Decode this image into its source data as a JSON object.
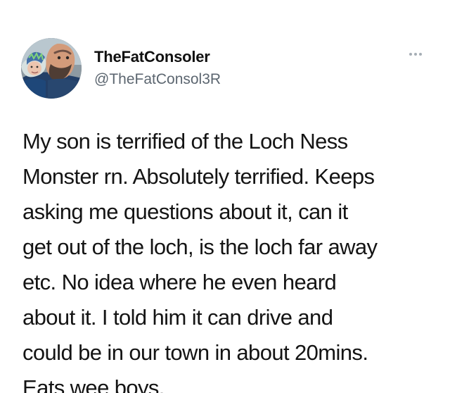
{
  "author": {
    "display_name": "TheFatConsoler",
    "handle": "@TheFatConsol3R",
    "avatar_icon": "profile-photo"
  },
  "menu": {
    "more_icon": "more-horizontal-icon"
  },
  "tweet": {
    "lines": [
      "My son is terrified of the Loch Ness",
      "Monster rn. Absolutely terrified. Keeps",
      "asking me questions about it, can it",
      "get out of the loch, is the loch far away",
      "etc. No idea where he even heard",
      "about it. I told him it can drive and",
      "could be in our town in about 20mins.",
      "Eats wee boys."
    ]
  },
  "colors": {
    "background": "#ffffff",
    "primary_text": "#141414",
    "secondary_text": "#5c6670",
    "more_icon": "#a6aeb5"
  }
}
